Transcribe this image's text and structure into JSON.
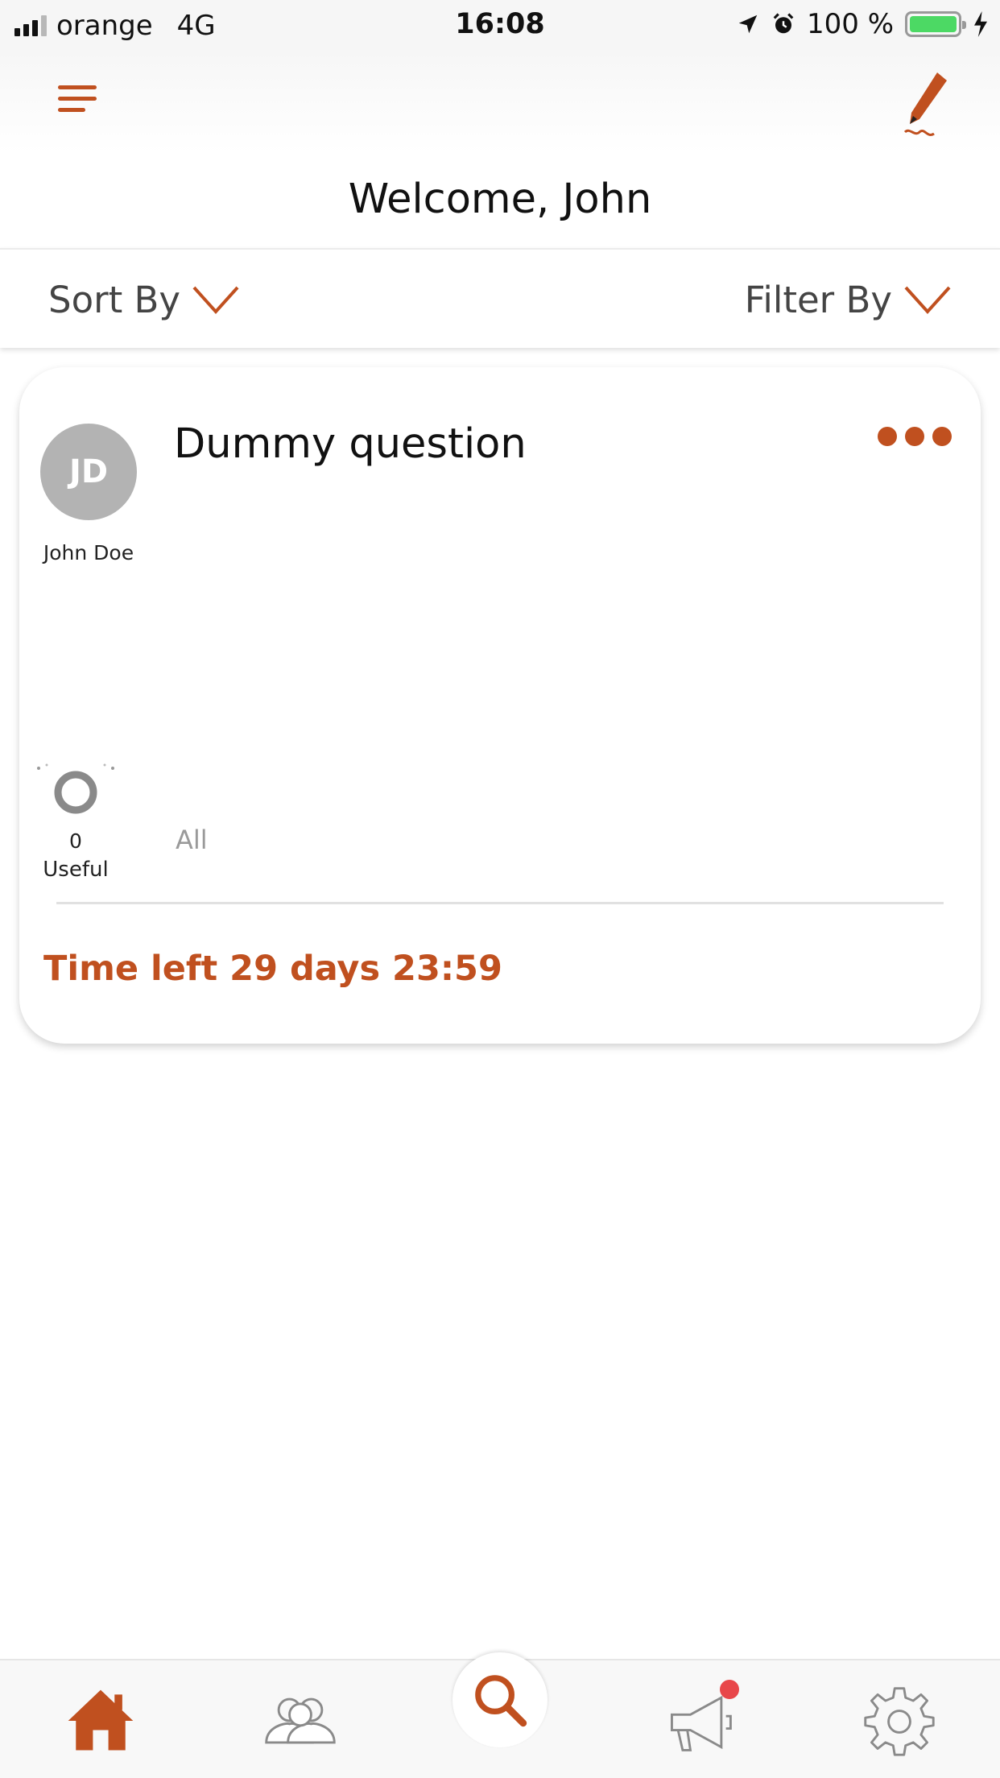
{
  "status_bar": {
    "carrier": "orange",
    "network": "4G",
    "time": "16:08",
    "battery": "100 %"
  },
  "header": {
    "welcome": "Welcome, John"
  },
  "sort_filter": {
    "sort_label": "Sort By",
    "filter_label": "Filter By"
  },
  "card": {
    "avatar_initials": "JD",
    "author": "John Doe",
    "title": "Dummy question",
    "useful_count": "0",
    "useful_label": "Useful",
    "all_label": "All",
    "time_left": "Time left 29 days 23:59"
  },
  "colors": {
    "accent": "#c0501f",
    "avatar_bg": "#b3b3b3",
    "notification": "#e8474a",
    "battery": "#4cd964"
  },
  "icons": {
    "menu": "menu-icon",
    "edit": "pencil-icon",
    "more": "more-dots-icon",
    "useful": "useful-ring-icon",
    "tabs": [
      "home-icon",
      "people-icon",
      "search-icon",
      "megaphone-icon",
      "settings-icon"
    ]
  }
}
